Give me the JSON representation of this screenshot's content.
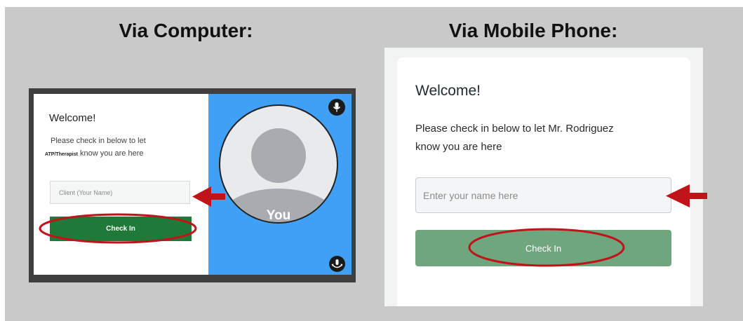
{
  "headings": {
    "computer": "Via Computer:",
    "mobile": "Via Mobile Phone:"
  },
  "computer": {
    "welcome": "Welcome!",
    "instruction_line1": "Please check in below to let",
    "therapist": "ATP/Therapist",
    "instruction_line2_rest": "know you are here",
    "name_placeholder": "Client (Your Name)",
    "checkin_label": "Check In",
    "avatar_label": "You"
  },
  "mobile": {
    "welcome": "Welcome!",
    "instruction_line1": "Please check in below to let Mr. Rodriguez",
    "instruction_line2": "know you are here",
    "name_placeholder": "Enter your name here",
    "checkin_label": "Check In"
  },
  "colors": {
    "background": "#c9c9c9",
    "desktop_button": "#1f7a3a",
    "mobile_button": "#6fa67e",
    "video_panel": "#3fa0f5",
    "annotation": "#c0131a"
  },
  "icons": {
    "mic": "microphone-icon",
    "rotate": "rotate-camera-icon"
  }
}
